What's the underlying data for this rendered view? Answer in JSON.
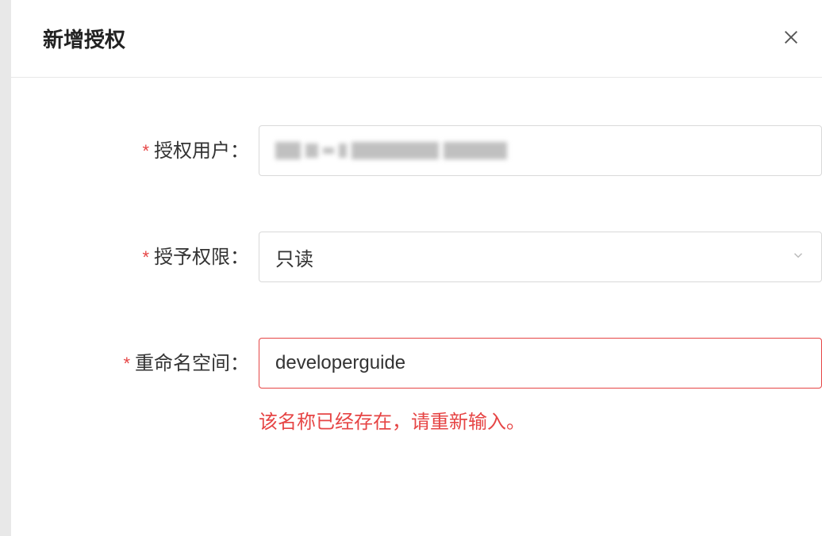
{
  "dialog": {
    "title": "新增授权"
  },
  "form": {
    "user": {
      "label": "授权用户："
    },
    "permission": {
      "label": "授予权限：",
      "value": "只读"
    },
    "namespace": {
      "label": "重命名空间：",
      "value": "developerguide",
      "error": "该名称已经存在，请重新输入。"
    }
  },
  "colors": {
    "error": "#e64545",
    "border": "#d9d9d9"
  }
}
